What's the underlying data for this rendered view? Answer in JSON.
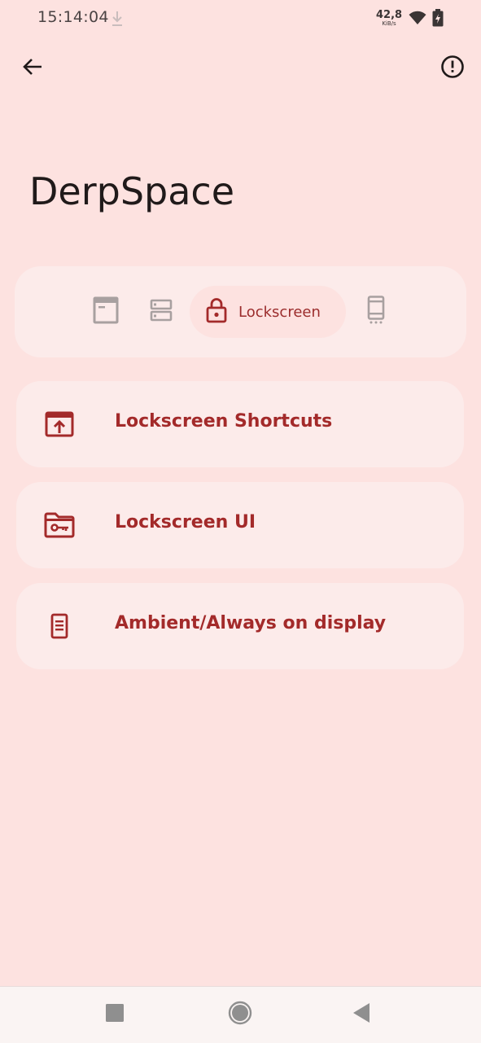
{
  "status_bar": {
    "time": "15:14:04",
    "net_rate_value": "42,8",
    "net_rate_unit": "KiB/s",
    "icons": [
      "download-icon",
      "wifi-icon",
      "battery-charging-icon"
    ]
  },
  "top_bar": {
    "back_icon": "arrow-back-icon",
    "info_icon": "info-outline-icon"
  },
  "page": {
    "title": "DerpSpace"
  },
  "tabs": {
    "items": [
      {
        "icon": "statusbar-icon",
        "label": "",
        "selected": false
      },
      {
        "icon": "quick-settings-icon",
        "label": "",
        "selected": false
      },
      {
        "icon": "lock-icon",
        "label": "Lockscreen",
        "selected": true
      },
      {
        "icon": "phone-icon",
        "label": "",
        "selected": false
      }
    ]
  },
  "list": {
    "items": [
      {
        "icon": "open-in-browser-icon",
        "label": "Lockscreen Shortcuts"
      },
      {
        "icon": "folder-key-icon",
        "label": "Lockscreen UI"
      },
      {
        "icon": "display-icon",
        "label": "Ambient/Always on display"
      }
    ]
  },
  "nav_bar": {
    "recent_icon": "square-icon",
    "home_icon": "circle-icon",
    "back_icon": "triangle-back-icon"
  },
  "colors": {
    "background": "#FDE2E0",
    "card": "#FCEBEA",
    "accent": "#A32A2A",
    "muted_icon": "#9E9696"
  }
}
